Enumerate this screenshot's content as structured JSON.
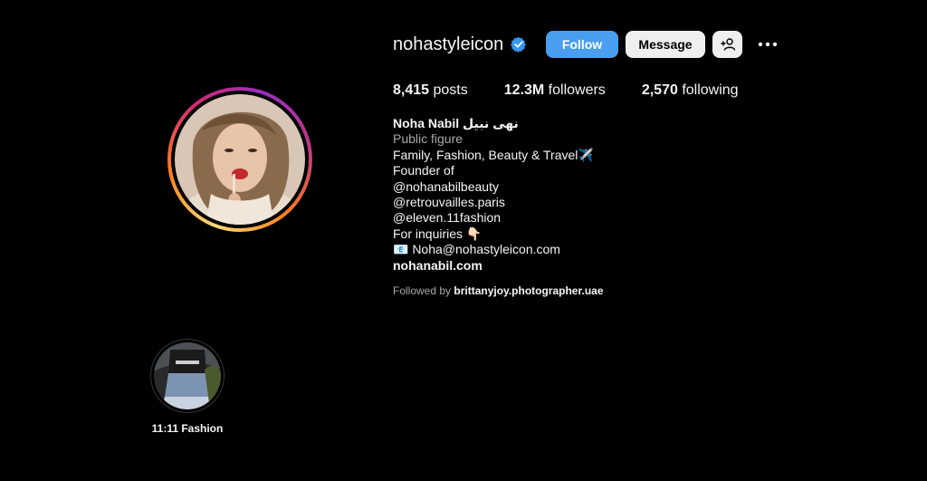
{
  "profile": {
    "username": "nohastyleicon",
    "verified_icon": "verified-badge-icon",
    "follow_label": "Follow",
    "message_label": "Message",
    "add_user_icon": "person-add-icon",
    "more_icon": "more-horizontal-icon"
  },
  "stats": {
    "posts_count": "8,415",
    "posts_label": "posts",
    "followers_count": "12.3M",
    "followers_label": "followers",
    "following_count": "2,570",
    "following_label": "following"
  },
  "bio": {
    "name": "Noha Nabil نهى نبيل",
    "category": "Public figure",
    "line1": "Family, Fashion, Beauty & Travel✈️",
    "line2": "Founder of",
    "line3": "@nohanabilbeauty",
    "line4": "@retrouvailles.paris",
    "line5": "@eleven.11fashion",
    "line6": "For inquiries 👇🏻",
    "line7": "📧 Noha@nohastyleicon.com",
    "link": "nohanabil.com"
  },
  "followed_by": {
    "prefix": "Followed by",
    "user": "brittanyjoy.photographer.uae"
  },
  "highlights": [
    {
      "label": "11:11 Fashion"
    }
  ],
  "colors": {
    "background": "#000000",
    "follow_button": "#4a9ef0",
    "secondary_button": "#efefef",
    "muted_text": "#a8a8a8",
    "verified": "#3897f0"
  }
}
